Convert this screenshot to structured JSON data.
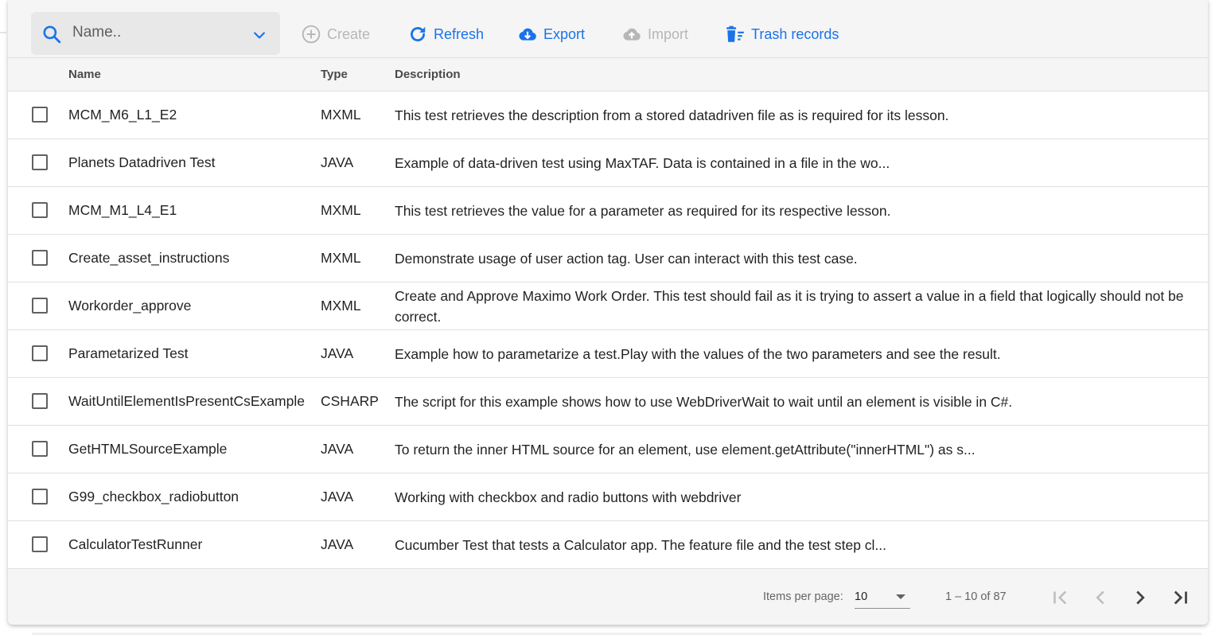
{
  "search": {
    "placeholder": "Name.."
  },
  "toolbar": {
    "create_label": "Create",
    "refresh_label": "Refresh",
    "export_label": "Export",
    "import_label": "Import",
    "trash_label": "Trash records"
  },
  "columns": {
    "name": "Name",
    "type": "Type",
    "description": "Description"
  },
  "rows": [
    {
      "name": "MCM_M6_L1_E2",
      "type": "MXML",
      "description": "This test retrieves the description from a stored datadriven file as is required for its lesson."
    },
    {
      "name": "Planets Datadriven Test",
      "type": "JAVA",
      "description": "Example of data-driven test using MaxTAF. Data is contained in a file in the wo..."
    },
    {
      "name": "MCM_M1_L4_E1",
      "type": "MXML",
      "description": "This test retrieves the value for a parameter as required for its respective lesson."
    },
    {
      "name": "Create_asset_instructions",
      "type": "MXML",
      "description": "Demonstrate usage of user action tag. User can interact with this test case."
    },
    {
      "name": "Workorder_approve",
      "type": "MXML",
      "description": "Create and Approve Maximo Work Order. This test should fail as it is trying to assert a value in a field that logically should not be correct."
    },
    {
      "name": "Parametarized Test",
      "type": "JAVA",
      "description": "Example how to parametarize a test.Play with the values of the two parameters and see the result."
    },
    {
      "name": "WaitUntilElementIsPresentCsExample",
      "type": "CSHARP",
      "description": "The script for this example shows how to use WebDriverWait to wait until an element is visible in C#."
    },
    {
      "name": "GetHTMLSourceExample",
      "type": "JAVA",
      "description": "To return the inner HTML source for an element, use element.getAttribute(\"innerHTML\") as s..."
    },
    {
      "name": "G99_checkbox_radiobutton",
      "type": "JAVA",
      "description": "Working with checkbox and radio buttons with webdriver"
    },
    {
      "name": "CalculatorTestRunner",
      "type": "JAVA",
      "description": "Cucumber Test that tests a Calculator app. The feature file and the test step cl..."
    }
  ],
  "paginator": {
    "items_per_page_label": "Items per page:",
    "items_per_page_value": "10",
    "range_label": "1 – 10 of 87"
  },
  "colors": {
    "accent": "#1a73e8",
    "disabled": "#b7b7b7"
  }
}
